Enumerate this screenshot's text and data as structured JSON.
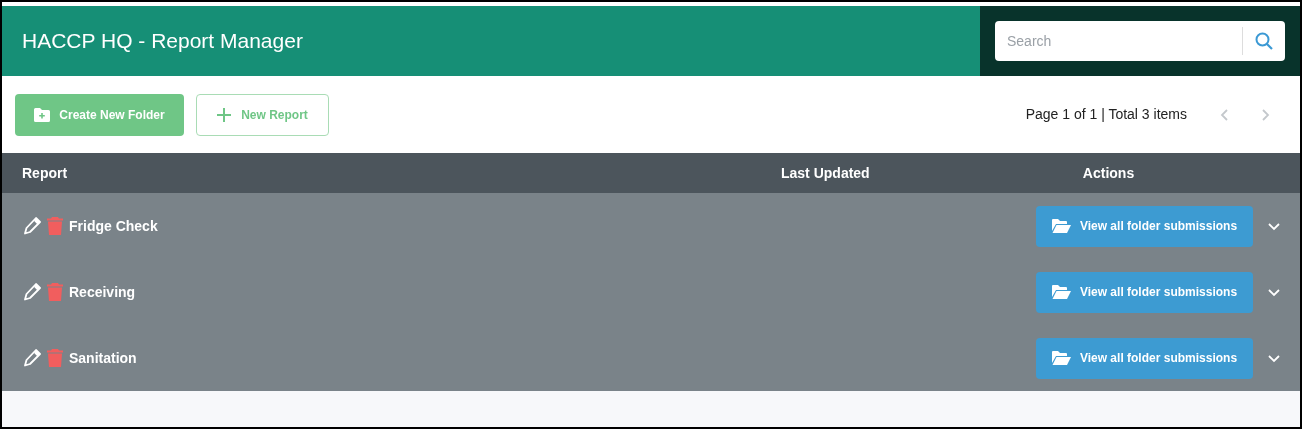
{
  "header": {
    "title": "HACCP HQ - Report Manager",
    "search": {
      "placeholder": "Search"
    }
  },
  "toolbar": {
    "buttons": [
      {
        "kind": "folder",
        "label": "Create New Folder"
      },
      {
        "kind": "add",
        "label": "New Report"
      }
    ],
    "pagination": {
      "summary": "Page 1 of 1 | Total 3 items",
      "prev_disabled": true,
      "next_disabled": true
    }
  },
  "table": {
    "columns": [
      "Report",
      "Last Updated",
      "Actions"
    ],
    "rows": [
      {
        "name": "Fridge Check",
        "action": "View all folder submissions"
      },
      {
        "name": "Receiving",
        "action": "View all folder submissions"
      },
      {
        "name": "Sanitation",
        "action": "View all folder submissions"
      }
    ]
  }
}
